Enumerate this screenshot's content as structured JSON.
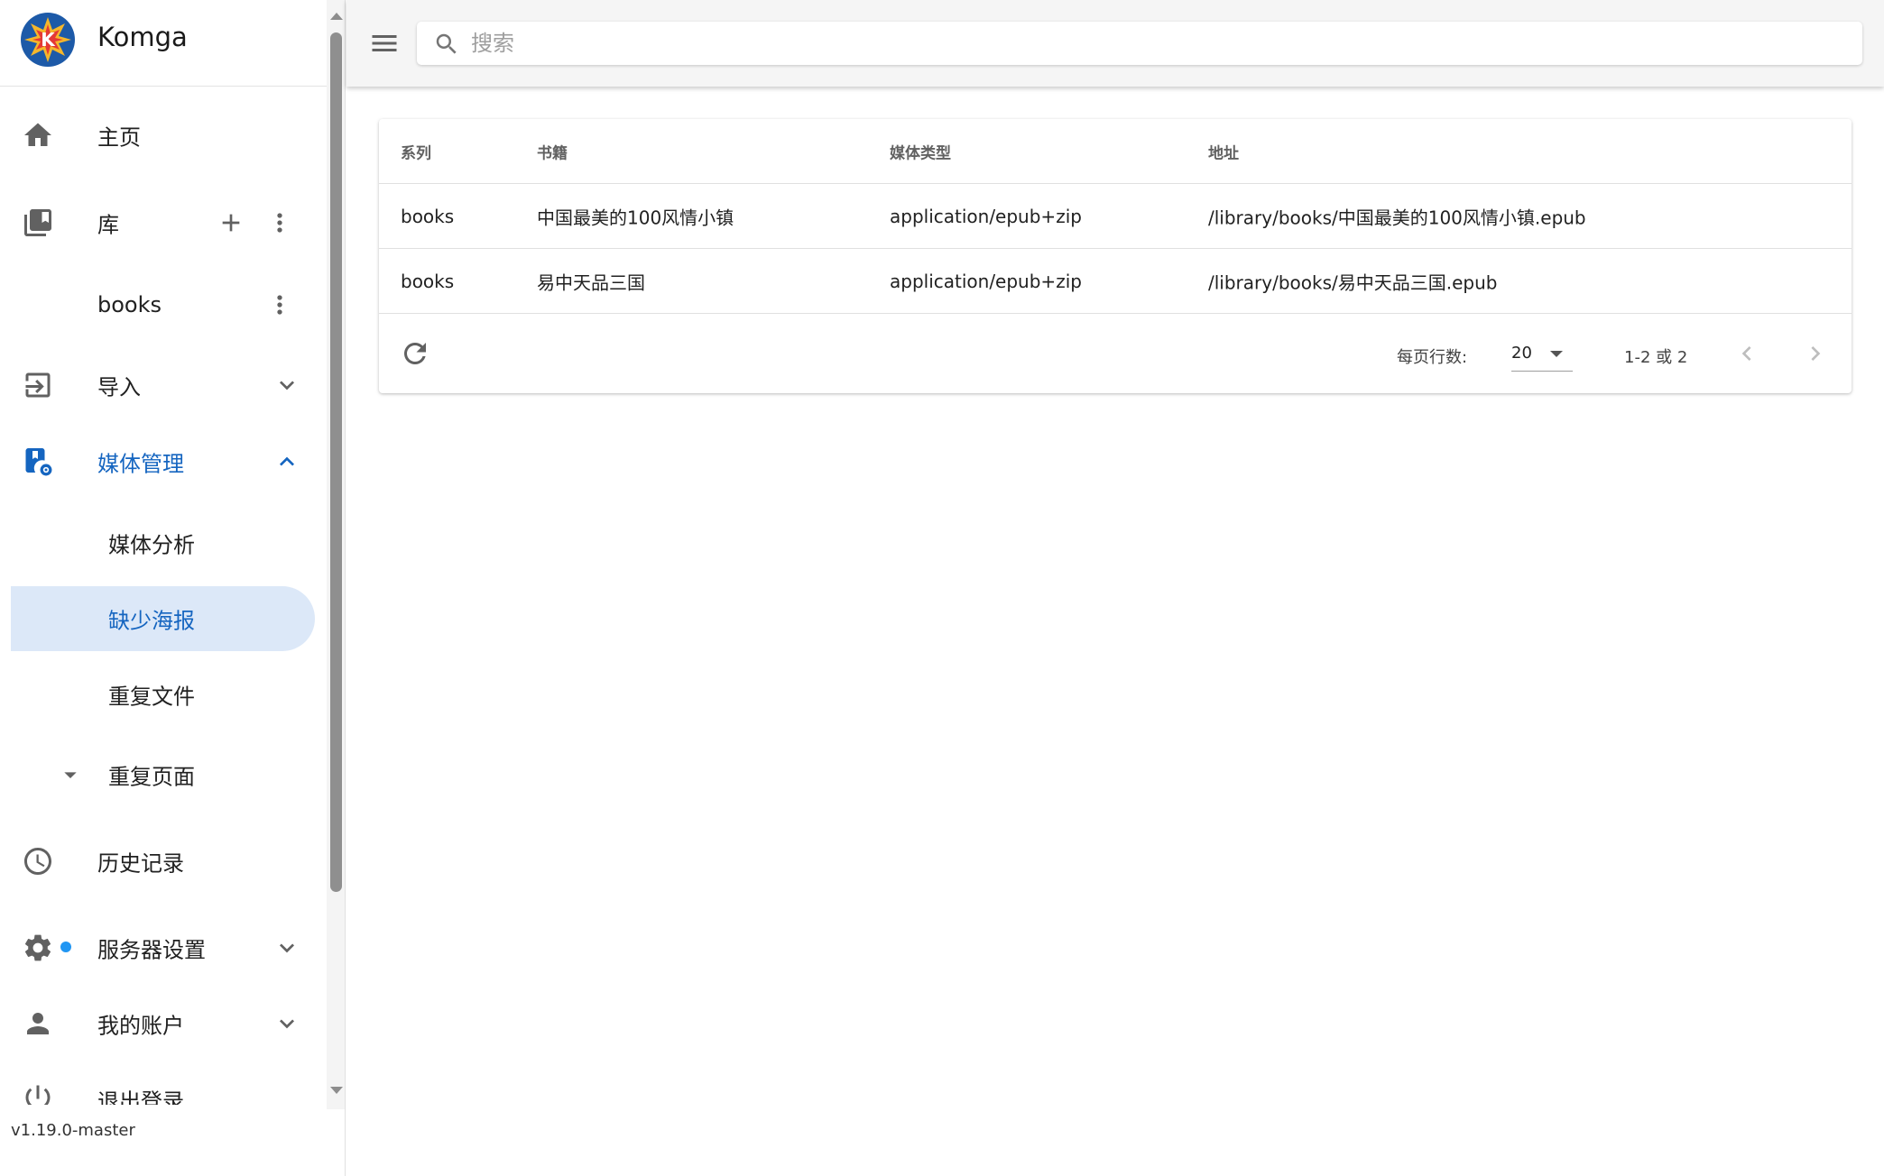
{
  "app": {
    "name": "Komga",
    "version": "v1.19.0-master"
  },
  "search": {
    "placeholder": "搜索",
    "value": ""
  },
  "sidebar": {
    "home": "主页",
    "libraries": "库",
    "library_items": [
      "books"
    ],
    "import": "导入",
    "media_management": {
      "label": "媒体管理",
      "children": [
        "媒体分析",
        "缺少海报",
        "重复文件",
        "重复页面"
      ],
      "selected": "缺少海报"
    },
    "history": "历史记录",
    "server_settings": "服务器设置",
    "my_account": "我的账户",
    "logout": "退出登录"
  },
  "table": {
    "headers": [
      "系列",
      "书籍",
      "媒体类型",
      "地址"
    ],
    "rows": [
      [
        "books",
        "中国最美的100风情小镇",
        "application/epub+zip",
        "/library/books/中国最美的100风情小镇.epub"
      ],
      [
        "books",
        "易中天品三国",
        "application/epub+zip",
        "/library/books/易中天品三国.epub"
      ]
    ],
    "footer": {
      "rows_per_page_label": "每页行数:",
      "rows_per_page": "20",
      "page_info": "1-2 或 2"
    }
  },
  "colors": {
    "accent": "#1565c0",
    "selected_bg": "#dce8f8",
    "badge": "#2196f3"
  },
  "icons": {
    "home": "home-icon",
    "library": "library-books-icon",
    "add": "plus-icon",
    "more": "dots-vertical-icon",
    "import": "import-icon",
    "media": "media-settings-icon",
    "history": "clock-icon",
    "settings": "gear-icon",
    "account": "person-icon",
    "logout": "power-icon",
    "menu": "menu-icon",
    "search": "search-icon",
    "refresh": "refresh-icon"
  }
}
